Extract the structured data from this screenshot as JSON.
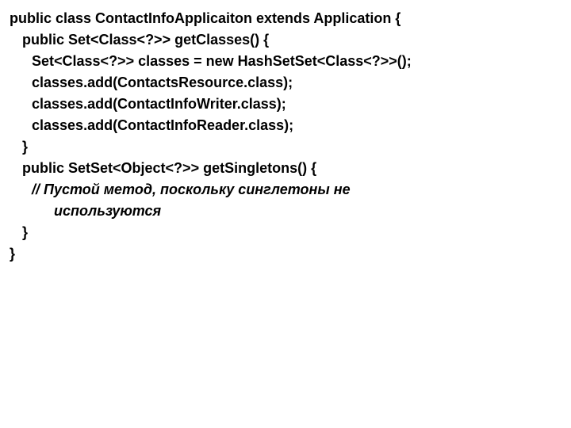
{
  "code": {
    "l1": "public class ContactInfoApplicaiton extends Application {",
    "l2": "public Set<Class<?>> getClasses() {",
    "l3": "Set<Class<?>> classes = new HashSetSet<Class<?>>();",
    "l4": "classes.add(ContactsResource.class);",
    "l5": "classes.add(ContactInfoWriter.class);",
    "l6": "classes.add(ContactInfoReader.class);",
    "l7": "}",
    "l8": "public SetSet<Object<?>> getSingletons() {",
    "l9": "// Пустой метод, поскольку синглетоны не",
    "l10": "используются",
    "l11": "}",
    "l12": "}"
  }
}
